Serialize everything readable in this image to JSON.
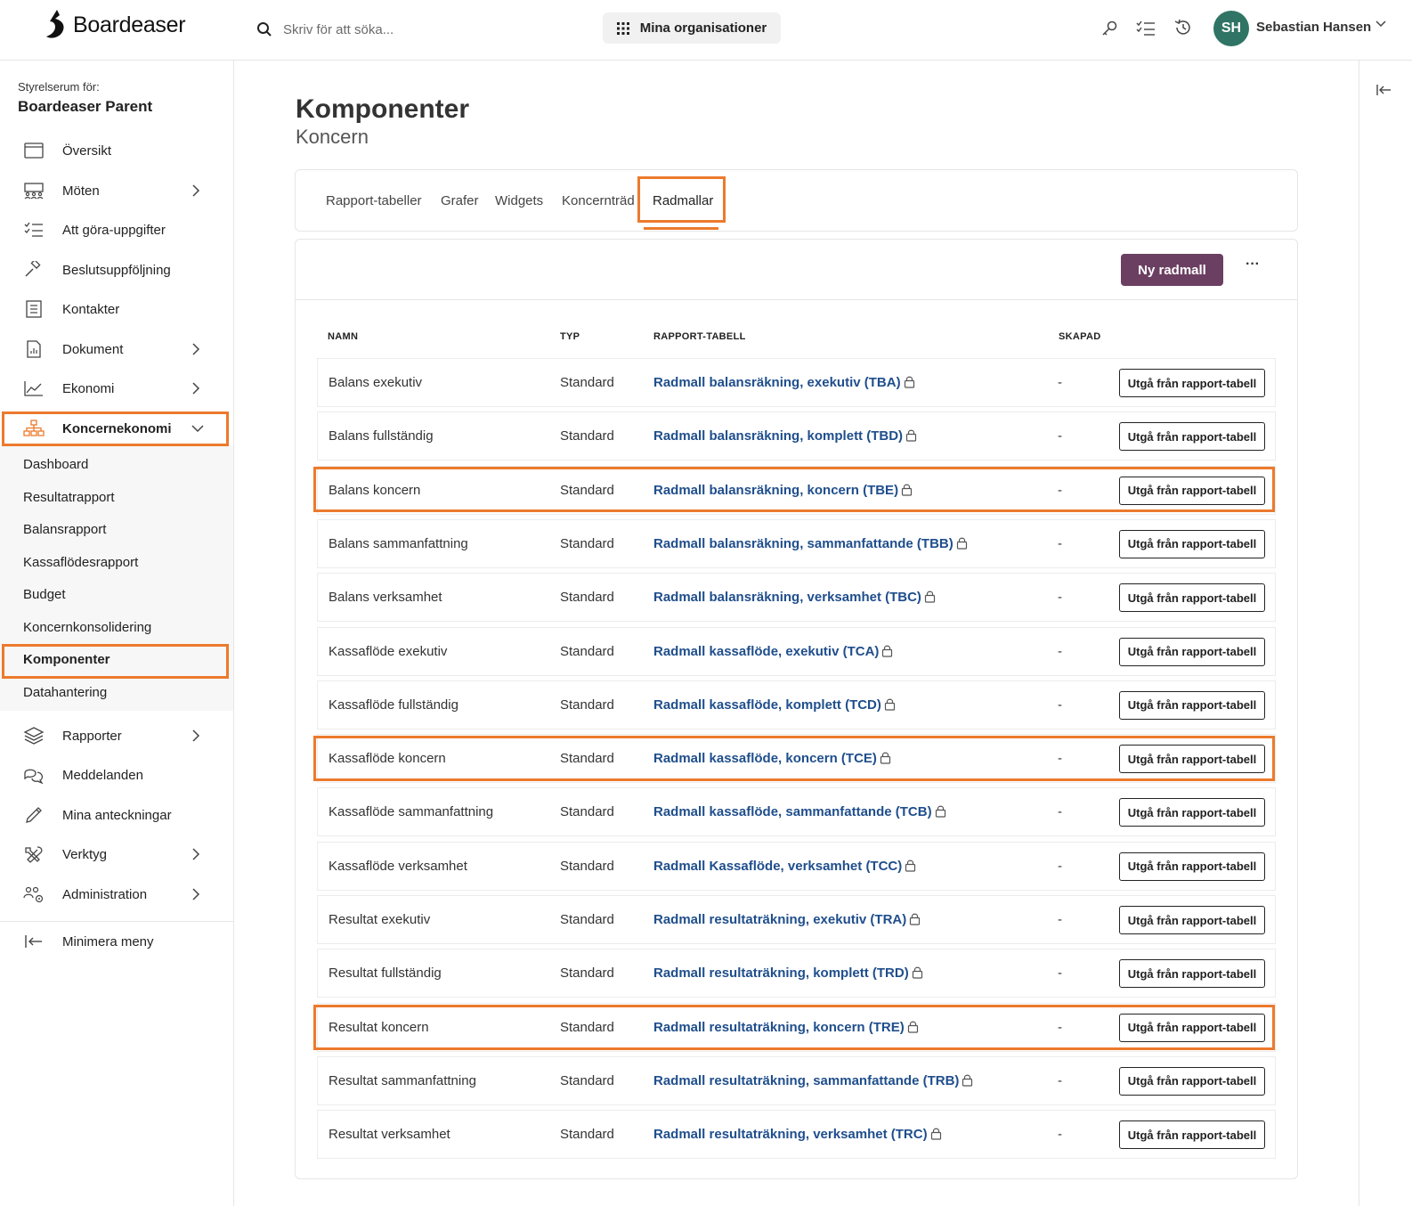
{
  "app": {
    "logo_text": "Boardeaser"
  },
  "topbar": {
    "search_placeholder": "Skriv för att söka...",
    "org_button": "Mina organisationer",
    "user_initials": "SH",
    "user_name": "Sebastian Hansen"
  },
  "sidebar": {
    "board_label": "Styrelserum för:",
    "board_name": "Boardeaser Parent",
    "items": [
      {
        "label": "Översikt",
        "icon": "calendar-icon"
      },
      {
        "label": "Möten",
        "icon": "meeting-icon"
      },
      {
        "label": "Att göra-uppgifter",
        "icon": "checklist-icon"
      },
      {
        "label": "Beslutsuppföljning",
        "icon": "gavel-icon"
      },
      {
        "label": "Kontakter",
        "icon": "contacts-icon"
      },
      {
        "label": "Dokument",
        "icon": "document-icon"
      },
      {
        "label": "Ekonomi",
        "icon": "chart-icon"
      },
      {
        "label": "Koncernekonomi",
        "icon": "hierarchy-icon"
      }
    ],
    "sub_items": [
      "Dashboard",
      "Resultatrapport",
      "Balansrapport",
      "Kassaflödesrapport",
      "Budget",
      "Koncernkonsolidering",
      "Komponenter",
      "Datahantering"
    ],
    "items_after": [
      {
        "label": "Rapporter",
        "icon": "layers-icon"
      },
      {
        "label": "Meddelanden",
        "icon": "chat-icon"
      },
      {
        "label": "Mina anteckningar",
        "icon": "pencil-icon"
      },
      {
        "label": "Verktyg",
        "icon": "tools-icon"
      },
      {
        "label": "Administration",
        "icon": "admin-icon"
      }
    ],
    "minimize": "Minimera meny"
  },
  "main": {
    "title": "Komponenter",
    "subtitle": "Koncern",
    "tabs": [
      "Rapport-tabeller",
      "Grafer",
      "Widgets",
      "Koncernträd",
      "Radmallar"
    ],
    "new_button": "Ny radmall",
    "more_button": "···",
    "columns": [
      "NAMN",
      "TYP",
      "RAPPORT-TABELL",
      "SKAPAD"
    ],
    "row_button": "Utgå från rapport-tabell",
    "rows": [
      {
        "name": "Balans exekutiv",
        "type": "Standard",
        "table": "Radmall balansräkning, exekutiv (TBA)",
        "created": "-"
      },
      {
        "name": "Balans fullständig",
        "type": "Standard",
        "table": "Radmall balansräkning, komplett (TBD)",
        "created": "-"
      },
      {
        "name": "Balans koncern",
        "type": "Standard",
        "table": "Radmall balansräkning, koncern (TBE)",
        "created": "-"
      },
      {
        "name": "Balans sammanfattning",
        "type": "Standard",
        "table": "Radmall balansräkning, sammanfattande (TBB)",
        "created": "-"
      },
      {
        "name": "Balans verksamhet",
        "type": "Standard",
        "table": "Radmall balansräkning, verksamhet (TBC)",
        "created": "-"
      },
      {
        "name": "Kassaflöde exekutiv",
        "type": "Standard",
        "table": "Radmall kassaflöde, exekutiv (TCA)",
        "created": "-"
      },
      {
        "name": "Kassaflöde fullständig",
        "type": "Standard",
        "table": "Radmall kassaflöde, komplett (TCD)",
        "created": "-"
      },
      {
        "name": "Kassaflöde koncern",
        "type": "Standard",
        "table": "Radmall kassaflöde, koncern (TCE)",
        "created": "-"
      },
      {
        "name": "Kassaflöde sammanfattning",
        "type": "Standard",
        "table": "Radmall kassaflöde, sammanfattande (TCB)",
        "created": "-"
      },
      {
        "name": "Kassaflöde verksamhet",
        "type": "Standard",
        "table": "Radmall Kassaflöde, verksamhet (TCC)",
        "created": "-"
      },
      {
        "name": "Resultat exekutiv",
        "type": "Standard",
        "table": "Radmall resultaträkning, exekutiv (TRA)",
        "created": "-"
      },
      {
        "name": "Resultat fullständig",
        "type": "Standard",
        "table": "Radmall resultaträkning, komplett (TRD)",
        "created": "-"
      },
      {
        "name": "Resultat koncern",
        "type": "Standard",
        "table": "Radmall resultaträkning, koncern (TRE)",
        "created": "-"
      },
      {
        "name": "Resultat sammanfattning",
        "type": "Standard",
        "table": "Radmall resultaträkning, sammanfattande (TRB)",
        "created": "-"
      },
      {
        "name": "Resultat verksamhet",
        "type": "Standard",
        "table": "Radmall resultaträkning, verksamhet (TRC)",
        "created": "-"
      }
    ]
  },
  "colors": {
    "accent": "#ec7a2d",
    "primary_button": "#6b3f62",
    "link": "#1f4e8c",
    "avatar": "#2f7464"
  }
}
